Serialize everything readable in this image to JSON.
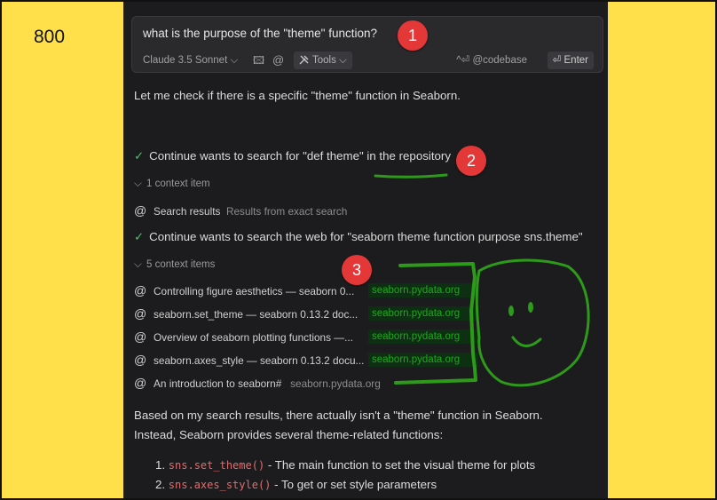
{
  "slide_label": "800",
  "input": {
    "query": "what is the purpose of the \"theme\" function?",
    "model": "Claude 3.5 Sonnet",
    "model_chevron": "⌵",
    "image_icon": "🖾",
    "at_icon": "@",
    "tools_label": "Tools",
    "codebase_label": "^⏎ @codebase",
    "enter_label": "⏎ Enter"
  },
  "response": {
    "intro": "Let me check if there is a specific \"theme\" function in Seaborn.",
    "step1": "Continue wants to search for \"def theme\" in the repository",
    "step1_context_count": "1 context item",
    "step1_item": {
      "title": "Search results",
      "source": "Results from exact search"
    },
    "step2": "Continue wants to search the web for \"seaborn theme function purpose sns.theme\"",
    "step2_context_count": "5 context items",
    "items": [
      {
        "title": "Controlling figure aesthetics — seaborn 0...",
        "source": "seaborn.pydata.org"
      },
      {
        "title": "seaborn.set_theme — seaborn 0.13.2 doc...",
        "source": "seaborn.pydata.org"
      },
      {
        "title": "Overview of seaborn plotting functions —...",
        "source": "seaborn.pydata.org"
      },
      {
        "title": "seaborn.axes_style — seaborn 0.13.2 docu...",
        "source": "seaborn.pydata.org"
      },
      {
        "title": "An introduction to seaborn#",
        "source": "seaborn.pydata.org"
      }
    ],
    "conclusion_line1": "Based on my search results, there actually isn't a \"theme\" function in Seaborn.",
    "conclusion_line2": "Instead, Seaborn provides several theme-related functions:",
    "list": [
      {
        "num": "1.",
        "code": "sns.set_theme()",
        "text": " - The main function to set the visual theme for plots"
      },
      {
        "num": "2.",
        "code": "sns.axes_style()",
        "text": " - To get or set style parameters"
      }
    ]
  },
  "annotations": {
    "badge1": "1",
    "badge2": "2",
    "badge3": "3"
  },
  "colors": {
    "accent_green": "#1fa81f",
    "badge_red": "#e43838",
    "background": "#ffe04b",
    "panel": "#1c1c1e"
  }
}
